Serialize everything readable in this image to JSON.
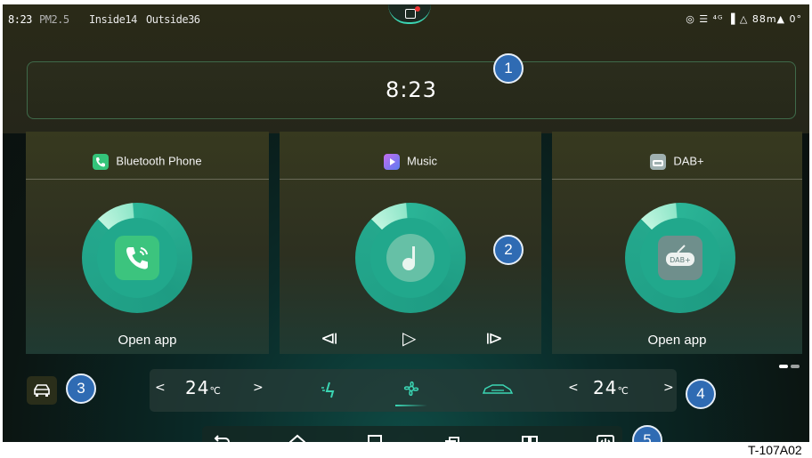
{
  "status_bar": {
    "time": "8:23",
    "pm_label": "PM2.5",
    "inside": "Inside14",
    "outside": "Outside36",
    "right_text": "◎ ☰ ⁴ᴳ ▐ △ 88m▲ 0°"
  },
  "clock": {
    "time": "8:23"
  },
  "cards": [
    {
      "title": "Bluetooth Phone",
      "action": "Open app",
      "icon": "phone-icon",
      "icon_color": "#34c47a"
    },
    {
      "title": "Music",
      "icon": "music-icon",
      "icon_color": "#9a5cf0",
      "controls": [
        "⧏",
        "▷",
        "⧐"
      ]
    },
    {
      "title": "DAB+",
      "action": "Open app",
      "icon": "radio-icon",
      "icon_color": "#a8b7b7",
      "orb_label": "DAB+"
    }
  ],
  "climate": {
    "left_temp": "24",
    "right_temp": "24",
    "unit": "℃",
    "left_prev": "<",
    "left_next": ">",
    "right_prev": "<",
    "right_next": ">"
  },
  "navbar": [
    "back-icon",
    "home-icon",
    "recents-icon",
    "multiwindow-icon",
    "split-icon",
    "power-icon"
  ],
  "badges": [
    "1",
    "2",
    "3",
    "4",
    "5"
  ],
  "image_code": "T-107A02",
  "colors": {
    "accent": "#3bd6b4",
    "badge": "#2f6bb3",
    "orb": "#21a88c"
  }
}
